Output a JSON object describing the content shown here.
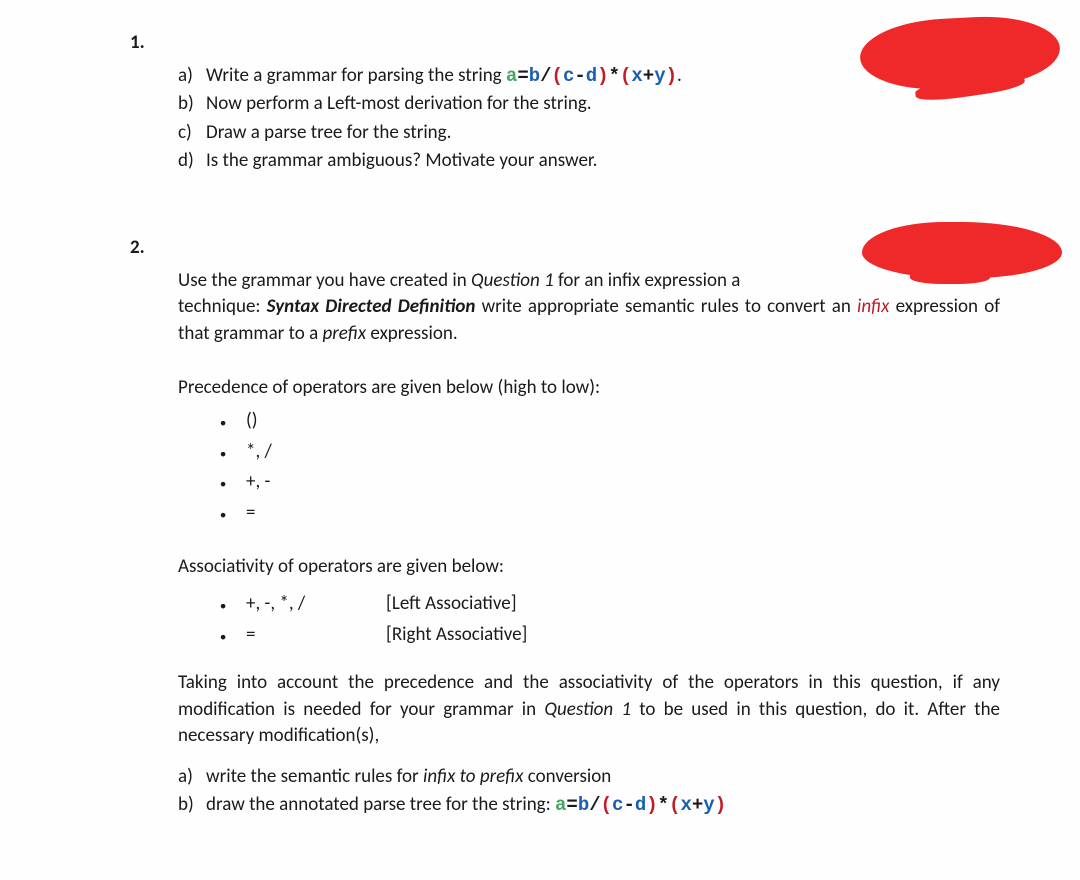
{
  "q1": {
    "number": "1.",
    "items": {
      "a": {
        "label": "a)",
        "pre": "Write a grammar for parsing the string ",
        "post": "."
      },
      "b": {
        "label": "b)",
        "text": "Now perform a Left-most derivation for the string."
      },
      "c": {
        "label": "c)",
        "text": "Draw a parse tree for the string."
      },
      "d": {
        "label": "d)",
        "text": "Is the grammar ambiguous? Motivate your answer."
      }
    },
    "expr": {
      "a": "a",
      "eq": "=",
      "b": "b",
      "slash": "/",
      "lp": "(",
      "c": "c",
      "minus": "-",
      "d": "d",
      "rp": ")",
      "star": "*",
      "x": "x",
      "plus": "+",
      "y": "y"
    }
  },
  "q2": {
    "number": "2.",
    "p1_a": "Use the grammar you have created in ",
    "p1_q1": "Question 1",
    "p1_b": " for an infix expression a",
    "p1_c": "technique: ",
    "p1_sdd": "Syntax Directed Definition",
    "p1_d": " write appropriate semantic rules to convert an ",
    "p1_infix": "infix",
    "p1_e": " expression of that grammar to a ",
    "p1_prefix": "prefix",
    "p1_f": " expression.",
    "prec_head": "Precedence of operators are given below (high to low):",
    "prec": [
      "()",
      "*, /",
      "+, -",
      "="
    ],
    "assoc_head": "Associativity of operators are given below:",
    "assoc": [
      {
        "ops": "+, -, *, /",
        "label": "[Left Associative]"
      },
      {
        "ops": "=",
        "label": "[Right Associative]"
      }
    ],
    "p2_a": "Taking into account the precedence and the associativity of the operators in this question, if any modification is needed for your grammar in ",
    "p2_q1": "Question 1",
    "p2_b": " to be used in this question, do it. After the necessary modification(s),",
    "items": {
      "a": {
        "label": "a)",
        "pre": "write the semantic rules for ",
        "em": "infix to prefix",
        "post": " conversion"
      },
      "b": {
        "label": "b)",
        "pre": "draw the annotated parse tree for the string: "
      }
    }
  }
}
